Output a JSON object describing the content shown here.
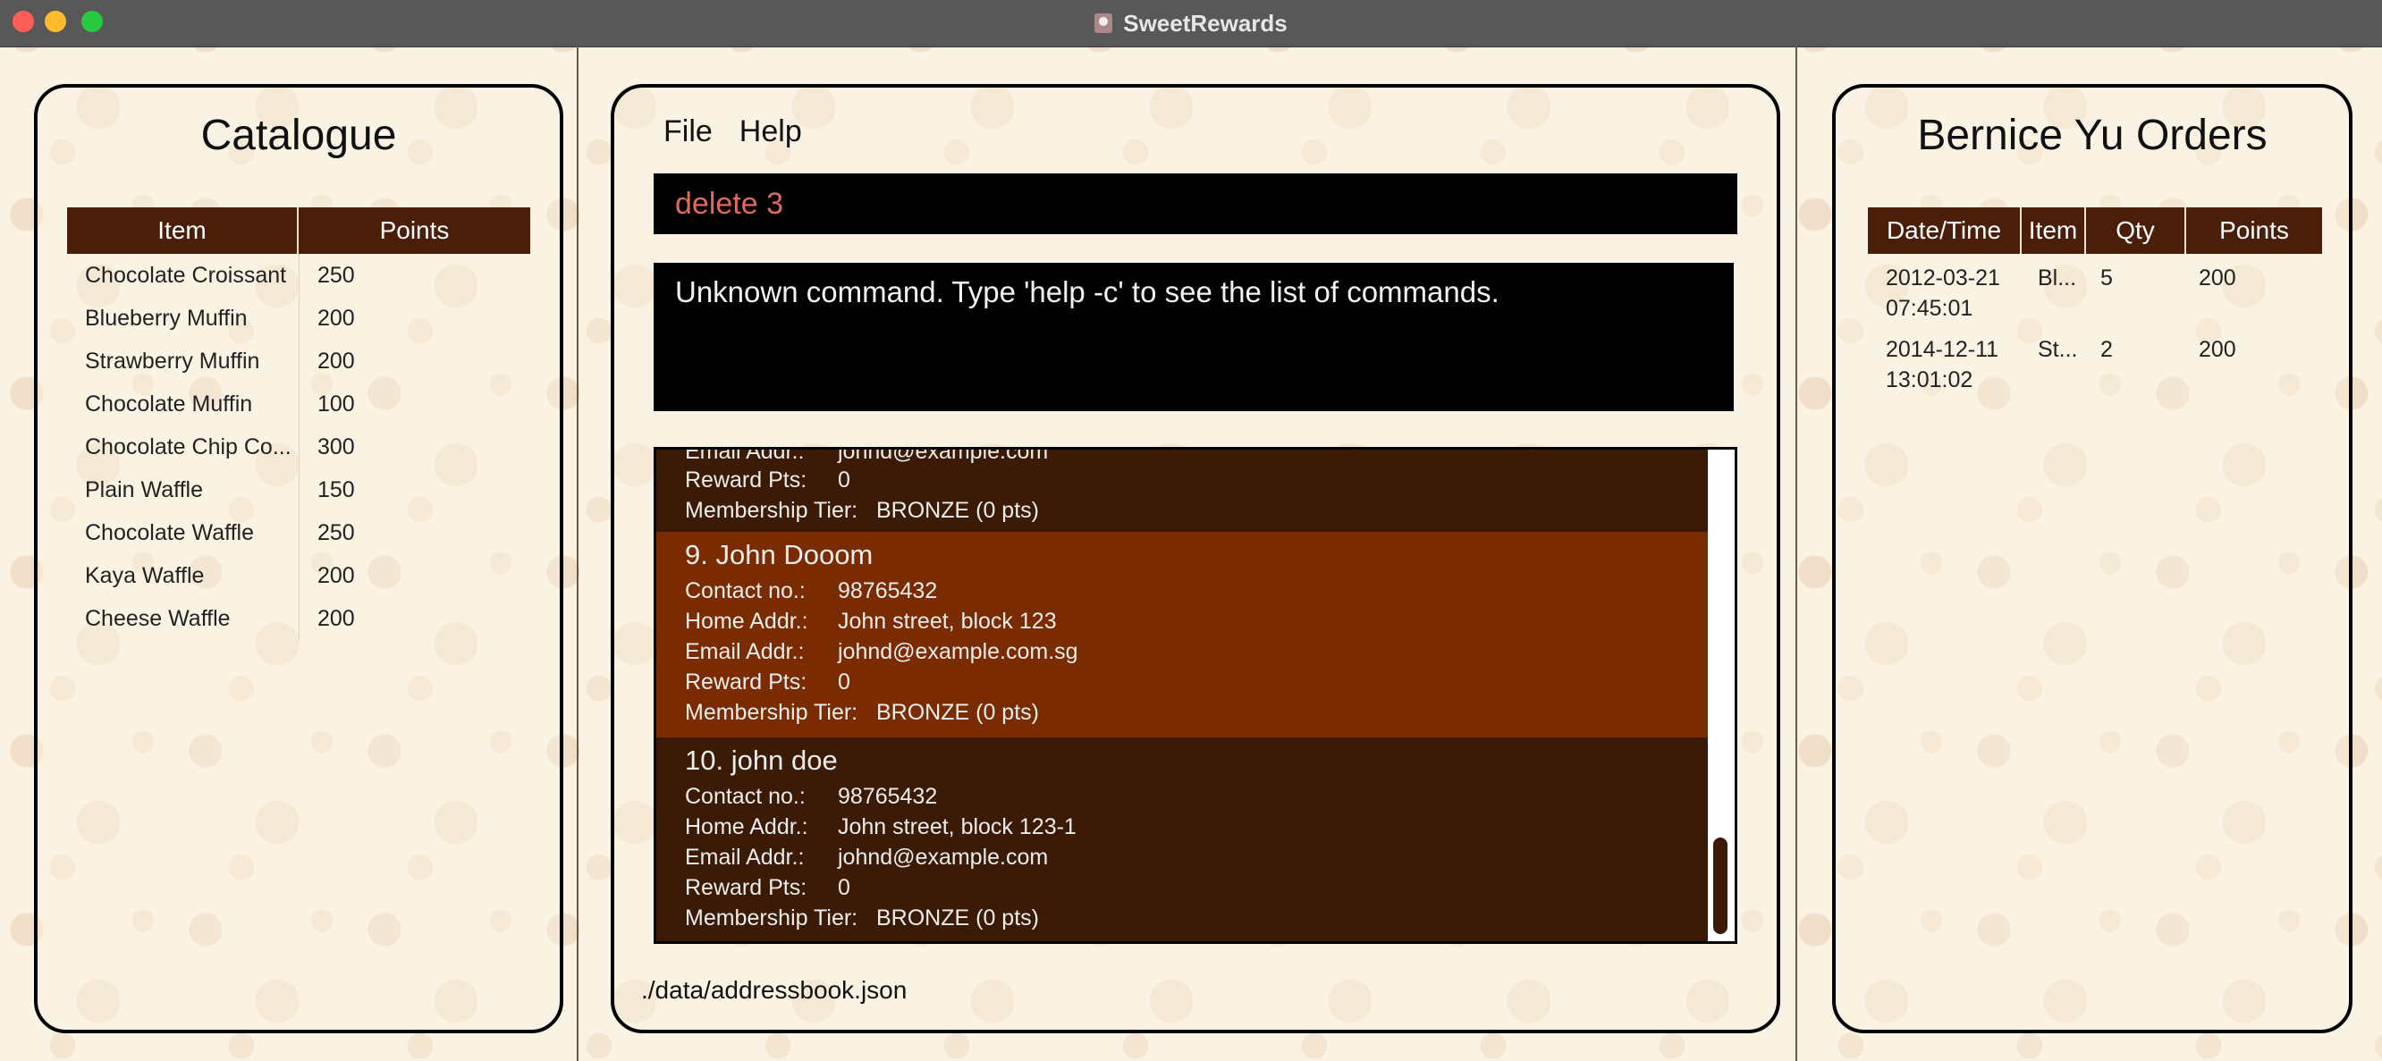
{
  "window": {
    "title": "SweetRewards"
  },
  "catalogue": {
    "title": "Catalogue",
    "headers": {
      "item": "Item",
      "points": "Points"
    },
    "rows": [
      {
        "item": "Chocolate Croissant",
        "points": "250"
      },
      {
        "item": "Blueberry Muffin",
        "points": "200"
      },
      {
        "item": "Strawberry Muffin",
        "points": "200"
      },
      {
        "item": "Chocolate Muffin",
        "points": "100"
      },
      {
        "item": "Chocolate Chip Co...",
        "points": "300"
      },
      {
        "item": "Plain Waffle",
        "points": "150"
      },
      {
        "item": "Chocolate Waffle",
        "points": "250"
      },
      {
        "item": "Kaya Waffle",
        "points": "200"
      },
      {
        "item": "Cheese Waffle",
        "points": "200"
      }
    ]
  },
  "menu": {
    "file": "File",
    "help": "Help"
  },
  "command": {
    "value": "delete 3"
  },
  "result": {
    "text": "Unknown command. Type 'help -c' to see the list of commands."
  },
  "labels": {
    "contact": "Contact no.:",
    "home": "Home Addr.:",
    "email": "Email Addr.:",
    "reward": "Reward Pts:",
    "tier": "Membership Tier:"
  },
  "customers": [
    {
      "partial": true,
      "email": "johnd@example.com",
      "reward": "0",
      "tier": "BRONZE (0 pts)"
    },
    {
      "index": "9.",
      "name": "John Dooom",
      "contact": "98765432",
      "home": "John street, block 123",
      "email": "johnd@example.com.sg",
      "reward": "0",
      "tier": "BRONZE (0 pts)",
      "selected": true
    },
    {
      "index": "10.",
      "name": "john doe",
      "contact": "98765432",
      "home": "John street, block 123-1",
      "email": "johnd@example.com",
      "reward": "0",
      "tier": "BRONZE (0 pts)"
    }
  ],
  "status": {
    "path": "./data/addressbook.json"
  },
  "orders": {
    "title": "Bernice Yu Orders",
    "headers": {
      "datetime": "Date/Time",
      "item": "Item",
      "qty": "Qty",
      "points": "Points"
    },
    "rows": [
      {
        "date": "2012-03-21",
        "time": "07:45:01",
        "item": "Bl...",
        "qty": "5",
        "points": "200"
      },
      {
        "date": "2014-12-11",
        "time": "13:01:02",
        "item": "St...",
        "qty": "2",
        "points": "200"
      }
    ]
  },
  "colors": {
    "header_bg": "#4a1e08",
    "card_bg": "#3b1a06",
    "card_selected_bg": "#7a2c00",
    "command_text": "#e06a5a"
  }
}
